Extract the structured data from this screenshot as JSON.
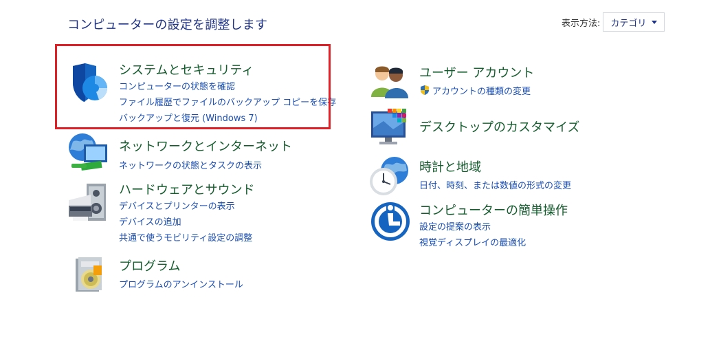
{
  "header": {
    "title": "コンピューターの設定を調整します",
    "view_by_label": "表示方法:",
    "view_by_value": "カテゴリ"
  },
  "left_categories": {
    "system": {
      "title": "システムとセキュリティ",
      "links": [
        "コンピューターの状態を確認",
        "ファイル履歴でファイルのバックアップ コピーを保存",
        "バックアップと復元 (Windows 7)"
      ]
    },
    "network": {
      "title": "ネットワークとインターネット",
      "links": [
        "ネットワークの状態とタスクの表示"
      ]
    },
    "hardware": {
      "title": "ハードウェアとサウンド",
      "links": [
        "デバイスとプリンターの表示",
        "デバイスの追加",
        "共通で使うモビリティ設定の調整"
      ]
    },
    "programs": {
      "title": "プログラム",
      "links": [
        "プログラムのアンインストール"
      ]
    }
  },
  "right_categories": {
    "users": {
      "title": "ユーザー アカウント",
      "links": [
        "アカウントの種類の変更"
      ]
    },
    "desktop": {
      "title": "デスクトップのカスタマイズ",
      "links": []
    },
    "clock": {
      "title": "時計と地域",
      "links": [
        "日付、時刻、または数値の形式の変更"
      ]
    },
    "ease": {
      "title": "コンピューターの簡単操作",
      "links": [
        "設定の提案の表示",
        "視覚ディスプレイの最適化"
      ]
    }
  },
  "colors": {
    "category_title": "#155c2e",
    "link": "#1b4fb4",
    "header_title": "#1e3287",
    "highlight_border": "#e01f26"
  }
}
